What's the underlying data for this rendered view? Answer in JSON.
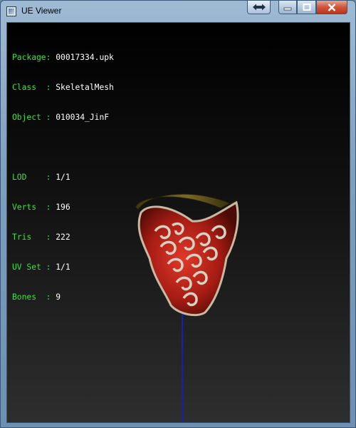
{
  "window": {
    "title": "UE Viewer",
    "controls": [
      "swap",
      "minimize",
      "maximize",
      "close"
    ]
  },
  "info": {
    "package_label": "Package:",
    "package_value": "00017334.upk",
    "class_label": "Class  :",
    "class_value": "SkeletalMesh",
    "object_label": "Object :",
    "object_value": "010034_JinF",
    "lod_label": "LOD    :",
    "lod_value": "1/1",
    "verts_label": "Verts  :",
    "verts_value": "196",
    "tris_label": "Tris   :",
    "tris_value": "222",
    "uvset_label": "UV Set :",
    "uvset_value": "1/1",
    "bones_label": "Bones  :",
    "bones_value": "9"
  },
  "colors": {
    "label_green": "#3fe03f",
    "value_white": "#ffffff",
    "axis_blue": "#1420b5",
    "mesh_red": "#b8231a"
  }
}
